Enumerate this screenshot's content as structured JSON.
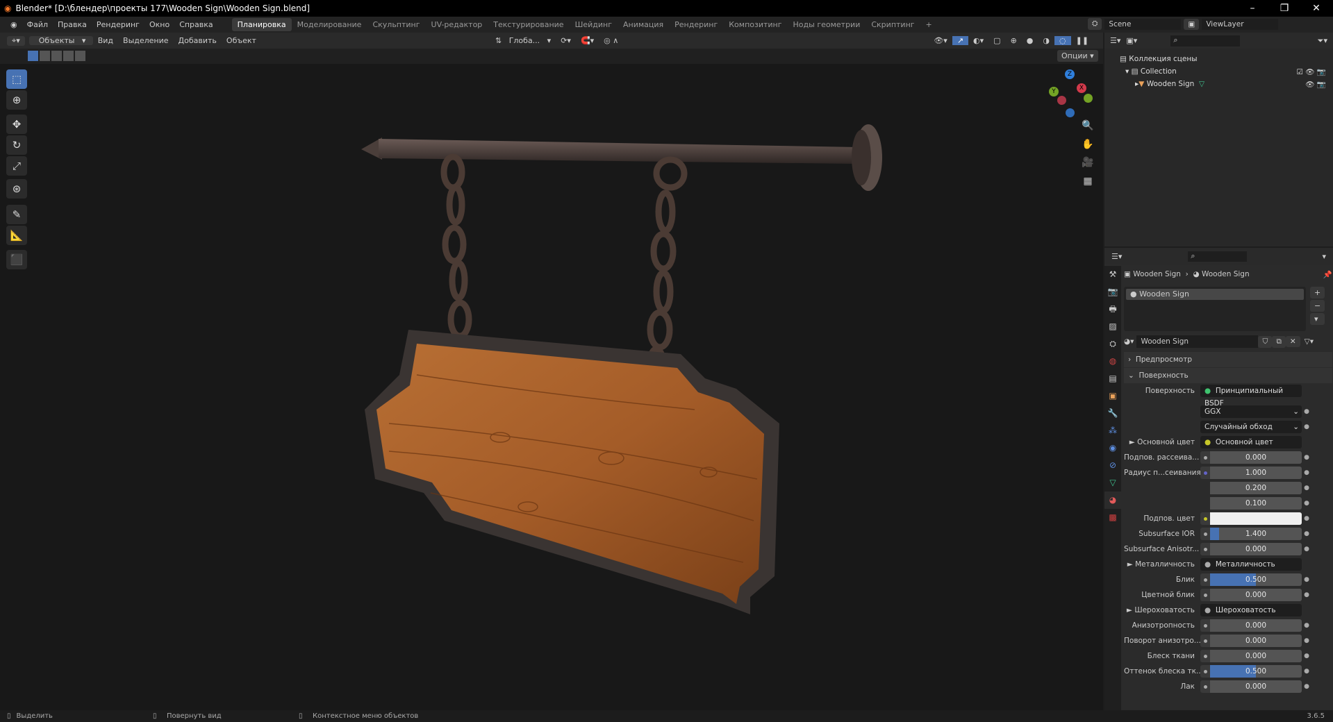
{
  "window": {
    "title": "Blender* [D:\\блендер\\проекты 177\\Wooden Sign\\Wooden Sign.blend]"
  },
  "menu": [
    "Файл",
    "Правка",
    "Рендеринг",
    "Окно",
    "Справка"
  ],
  "workspaces": [
    "Планировка",
    "Моделирование",
    "Скульптинг",
    "UV-редактор",
    "Текстурирование",
    "Шейдинг",
    "Анимация",
    "Рендеринг",
    "Композитинг",
    "Ноды геометрии",
    "Скриптинг",
    "+"
  ],
  "scene": {
    "name": "Scene",
    "view_layer": "ViewLayer"
  },
  "viewport_header": {
    "mode": "Объекты",
    "menus": [
      "Вид",
      "Выделение",
      "Добавить",
      "Объект"
    ],
    "transform": "Глоба...",
    "options": "Опции"
  },
  "gizmo": {
    "axes": [
      "Z",
      "Y",
      "X"
    ]
  },
  "outliner": {
    "root": "Коллекция сцены",
    "collection": "Collection",
    "object": "Wooden Sign"
  },
  "properties": {
    "breadcrumb": [
      "Wooden Sign",
      "Wooden Sign"
    ],
    "slot": "Wooden Sign",
    "material": "Wooden Sign",
    "panels": {
      "preview": "Предпросмотр",
      "surface": "Поверхность"
    },
    "surface_label": "Поверхность",
    "surface_value": "Принципиальный BSDF",
    "distribution": "GGX",
    "subsurface_method": "Случайный обход",
    "rows": [
      {
        "label": "Основной цвет",
        "type": "link",
        "value": "Основной цвет",
        "socket": "#c7c729"
      },
      {
        "label": "Подпов. рассеива...",
        "type": "num",
        "value": "0.000",
        "fill": 0
      },
      {
        "label": "Радиус п...сеивания",
        "type": "num",
        "value": "1.000",
        "fill": 0,
        "socket": "#6363c7"
      },
      {
        "label": "",
        "type": "num",
        "value": "0.200",
        "fill": 0
      },
      {
        "label": "",
        "type": "num",
        "value": "0.100",
        "fill": 0
      },
      {
        "label": "Подпов. цвет",
        "type": "color",
        "value": "",
        "color": "#f0f0f0",
        "socket": "#c7c729"
      },
      {
        "label": "Subsurface IOR",
        "type": "num",
        "value": "1.400",
        "fill": 0.1
      },
      {
        "label": "Subsurface Anisotr...",
        "type": "num",
        "value": "0.000",
        "fill": 0
      },
      {
        "label": "Металличность",
        "type": "link",
        "value": "Металличность"
      },
      {
        "label": "Блик",
        "type": "num",
        "value": "0.500",
        "fill": 0.5
      },
      {
        "label": "Цветной блик",
        "type": "num",
        "value": "0.000",
        "fill": 0
      },
      {
        "label": "Шероховатость",
        "type": "link",
        "value": "Шероховатость"
      },
      {
        "label": "Анизотропность",
        "type": "num",
        "value": "0.000",
        "fill": 0
      },
      {
        "label": "Поворот анизотро...",
        "type": "num",
        "value": "0.000",
        "fill": 0
      },
      {
        "label": "Блеск ткани",
        "type": "num",
        "value": "0.000",
        "fill": 0
      },
      {
        "label": "Оттенок блеска тк...",
        "type": "num",
        "value": "0.500",
        "fill": 0.5
      },
      {
        "label": "Лак",
        "type": "num",
        "value": "0.000",
        "fill": 0
      }
    ]
  },
  "status": {
    "left": "Выделить",
    "middle": "Повернуть вид",
    "right": "Контекстное меню объектов",
    "version": "3.6.5"
  },
  "colors": {
    "accent": "#4772b3",
    "wood": "#a8622a",
    "iron": "#4a4040"
  }
}
